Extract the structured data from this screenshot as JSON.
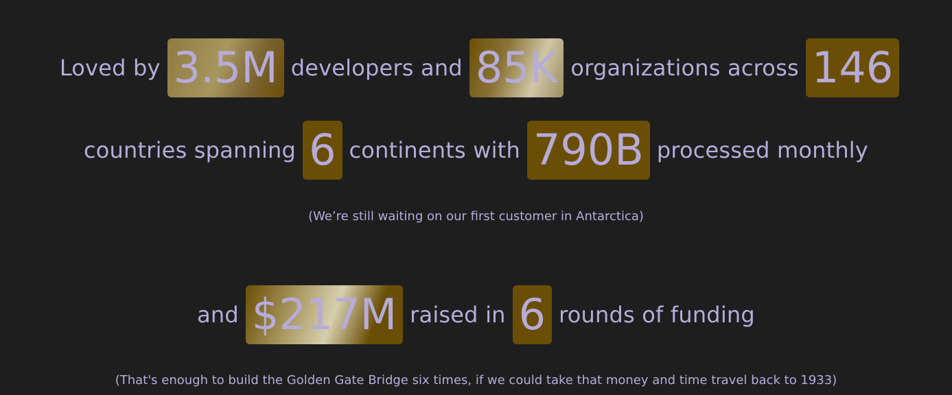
{
  "block1": {
    "line1": {
      "t1": "Loved by",
      "s1": "3.5M",
      "t2": "developers and",
      "s2": "85K",
      "t3": "organizations across",
      "s3": "146"
    },
    "line2": {
      "t1": "countries spanning",
      "s1": "6",
      "t2": "continents with",
      "s2": "790B",
      "t3": "processed monthly"
    },
    "note": "(We’re still waiting on our first customer in Antarctica)"
  },
  "block2": {
    "line1": {
      "t1": "and",
      "s1": "$217M",
      "t2": "raised in",
      "s2": "6",
      "t3": "rounds of funding"
    },
    "note": "(That's enough to build the Golden Gate Bridge six times, if we could take that money and time travel back to 1933)"
  },
  "colors": {
    "background": "#1e1e1f",
    "text": "#b6acd9",
    "highlight": "#6b4e05"
  }
}
